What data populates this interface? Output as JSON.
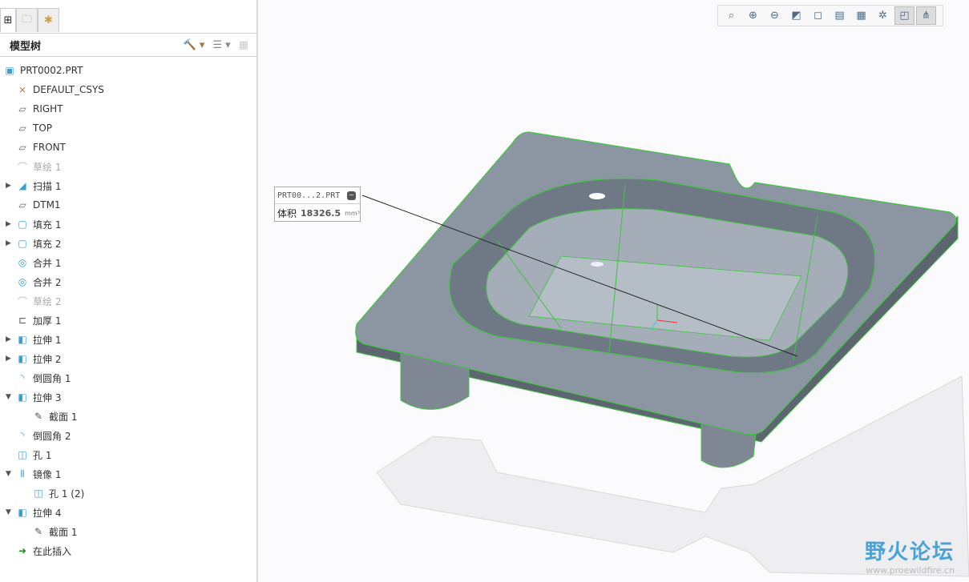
{
  "tabs": [
    {
      "name": "model-tree",
      "icon": "tree-icon"
    },
    {
      "name": "folder-browser",
      "icon": "folders-icon"
    },
    {
      "name": "favorites",
      "icon": "favorites-folder-icon"
    }
  ],
  "panel": {
    "title": "模型树",
    "tools": [
      "settings-icon",
      "show-icon",
      "filter-icon"
    ]
  },
  "tree": [
    {
      "label": "PRT0002.PRT",
      "icon": "part-icon",
      "indent": 0,
      "exp": ""
    },
    {
      "label": "DEFAULT_CSYS",
      "icon": "csys-icon",
      "indent": 1,
      "exp": ""
    },
    {
      "label": "RIGHT",
      "icon": "plane-icon",
      "indent": 1,
      "exp": ""
    },
    {
      "label": "TOP",
      "icon": "plane-icon",
      "indent": 1,
      "exp": ""
    },
    {
      "label": "FRONT",
      "icon": "plane-icon",
      "indent": 1,
      "exp": ""
    },
    {
      "label": "草绘 1",
      "icon": "sketch-icon",
      "indent": 1,
      "exp": "",
      "grey": true
    },
    {
      "label": "扫描 1",
      "icon": "sweep-icon",
      "indent": 1,
      "exp": "▶"
    },
    {
      "label": "DTM1",
      "icon": "plane-icon",
      "indent": 1,
      "exp": ""
    },
    {
      "label": "填充 1",
      "icon": "fill-icon",
      "indent": 1,
      "exp": "▶"
    },
    {
      "label": "填充 2",
      "icon": "fill-icon",
      "indent": 1,
      "exp": "▶"
    },
    {
      "label": "合并 1",
      "icon": "merge-icon",
      "indent": 1,
      "exp": ""
    },
    {
      "label": "合并 2",
      "icon": "merge-icon",
      "indent": 1,
      "exp": ""
    },
    {
      "label": "草绘 2",
      "icon": "sketch-icon",
      "indent": 1,
      "exp": "",
      "grey": true
    },
    {
      "label": "加厚 1",
      "icon": "thicken-icon",
      "indent": 1,
      "exp": ""
    },
    {
      "label": "拉伸 1",
      "icon": "extrude-icon",
      "indent": 1,
      "exp": "▶"
    },
    {
      "label": "拉伸 2",
      "icon": "extrude-icon",
      "indent": 1,
      "exp": "▶"
    },
    {
      "label": "倒圆角 1",
      "icon": "round-icon",
      "indent": 1,
      "exp": ""
    },
    {
      "label": "拉伸 3",
      "icon": "extrude-icon",
      "indent": 1,
      "exp": "▼"
    },
    {
      "label": "截面 1",
      "icon": "section-icon",
      "indent": 2,
      "exp": ""
    },
    {
      "label": "倒圆角 2",
      "icon": "round-icon",
      "indent": 1,
      "exp": ""
    },
    {
      "label": "孔 1",
      "icon": "hole-icon",
      "indent": 1,
      "exp": ""
    },
    {
      "label": "镜像 1",
      "icon": "mirror-icon",
      "indent": 1,
      "exp": "▼"
    },
    {
      "label": "孔 1 (2)",
      "icon": "hole-icon",
      "indent": 2,
      "exp": ""
    },
    {
      "label": "拉伸 4",
      "icon": "extrude-icon",
      "indent": 1,
      "exp": "▼"
    },
    {
      "label": "截面 1",
      "icon": "section-icon",
      "indent": 2,
      "exp": ""
    },
    {
      "label": "在此插入",
      "icon": "insert-arrow-icon",
      "indent": 1,
      "exp": ""
    }
  ],
  "view_toolbar": [
    "refit-icon",
    "zoom-in-icon",
    "zoom-out-icon",
    "repaint-icon",
    "display-style-icon",
    "saved-views-icon",
    "view-manager-icon",
    "datum-display-icon",
    "annotation-display-icon",
    "spin-center-icon"
  ],
  "note": {
    "title": "PRT00...2.PRT",
    "label": "体积",
    "value": "18326.5",
    "unit": "mm³"
  },
  "watermark": {
    "name": "野火论坛",
    "url": "www.proewildfire.cn"
  }
}
